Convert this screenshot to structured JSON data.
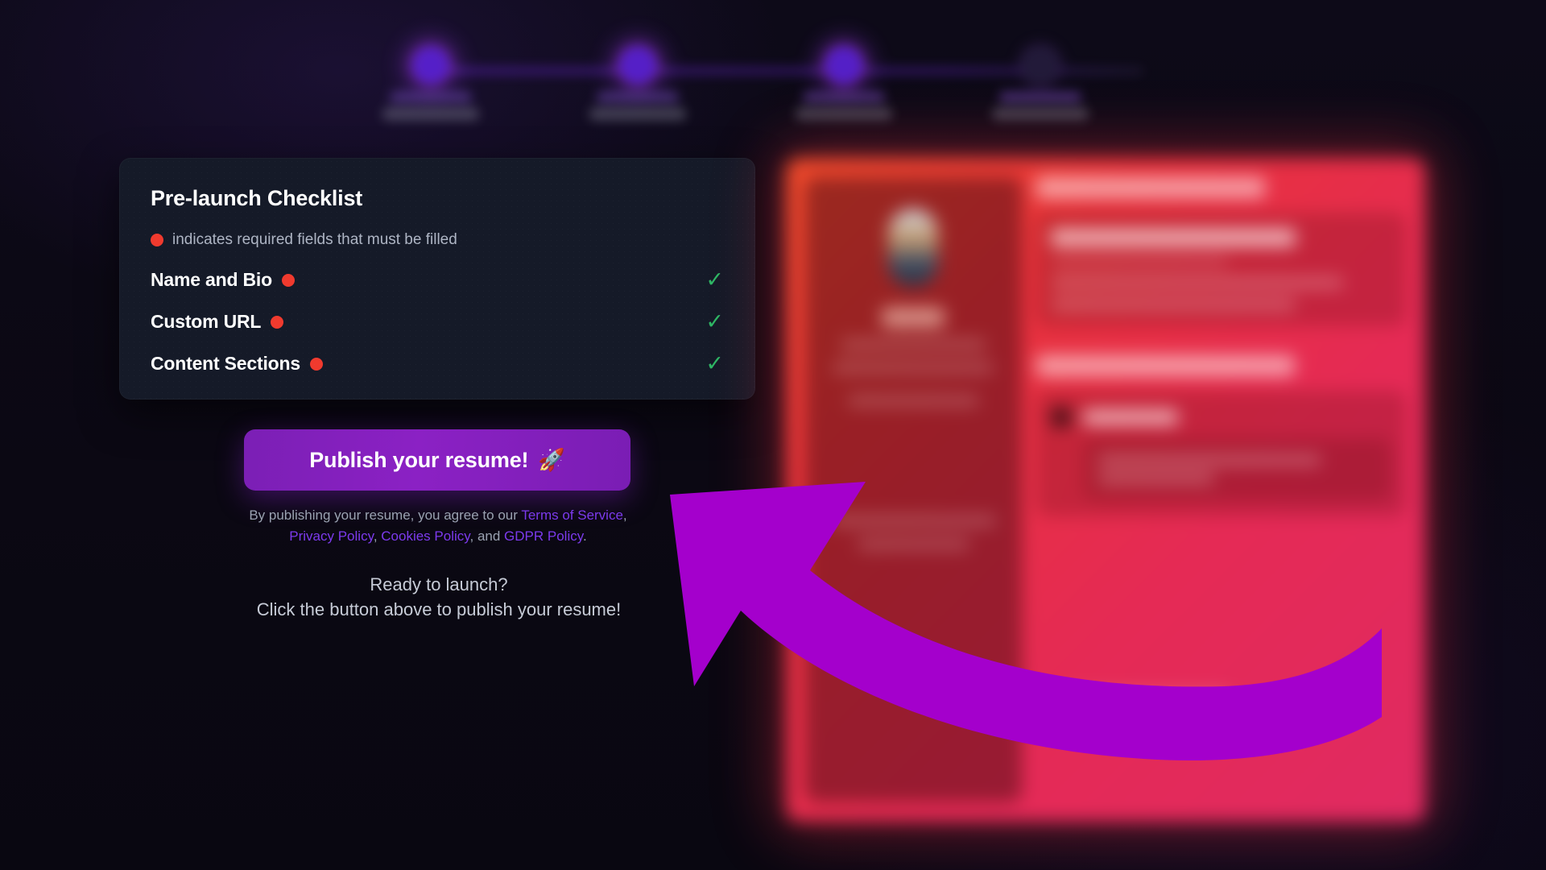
{
  "theme": {
    "page_bg": "#0b0814",
    "card_bg": "#151a28",
    "accent_purple": "#7c3aed",
    "button_purple": "#8b21c4",
    "required_red": "#f03a2e",
    "check_green": "#2eb765",
    "preview_red": "#e8323c",
    "arrow_magenta": "#a400cc"
  },
  "stepper": {
    "steps": [
      {
        "index": 1,
        "state": "complete",
        "label": "blurred-step-label"
      },
      {
        "index": 2,
        "state": "complete",
        "label": "blurred-step-label"
      },
      {
        "index": 3,
        "state": "complete",
        "label": "blurred-step-label"
      },
      {
        "index": 4,
        "state": "upcoming",
        "label": "blurred-step-label"
      }
    ]
  },
  "checklist": {
    "title": "Pre-launch Checklist",
    "legend": "indicates required fields that must be filled",
    "legend_dot_icon": "required-dot-icon",
    "items": [
      {
        "label": "Name and Bio",
        "required": true,
        "complete": true,
        "check_icon": "check-icon"
      },
      {
        "label": "Custom URL",
        "required": true,
        "complete": true,
        "check_icon": "check-icon"
      },
      {
        "label": "Content Sections",
        "required": true,
        "complete": true,
        "check_icon": "check-icon"
      }
    ]
  },
  "publish": {
    "button_label": "Publish your resume!",
    "button_icon": "rocket-icon",
    "button_emoji": "🚀"
  },
  "legal": {
    "prefix": "By publishing your resume, you agree to our ",
    "terms": "Terms of Service",
    "sep1": ", ",
    "privacy": "Privacy Policy",
    "sep2": ", ",
    "cookies": "Cookies Policy",
    "sep3": ", and ",
    "gdpr": "GDPR Policy",
    "suffix": "."
  },
  "ready": {
    "line1": "Ready to launch?",
    "line2": "Click the button above to publish your resume!"
  },
  "preview": {
    "name": "resume-preview-panel",
    "state": "blurred"
  },
  "annotation": {
    "name": "curved-arrow-annotation",
    "points_to": "publish-button",
    "color": "#a400cc"
  }
}
